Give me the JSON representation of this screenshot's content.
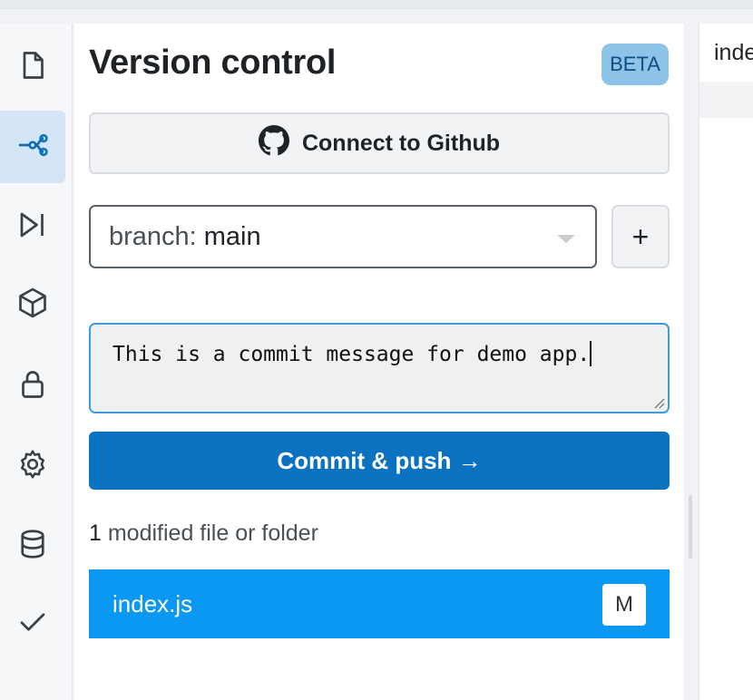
{
  "panel": {
    "title": "Version control",
    "badge": "BETA",
    "github_button": "Connect to Github",
    "branch": {
      "label": "branch:",
      "value": "main"
    },
    "add_branch": "+",
    "commit_message": "This is a commit message for demo app.",
    "push_button": "Commit & push →",
    "modified": {
      "count": "1",
      "text": "modified file or folder"
    },
    "files": [
      {
        "name": "index.js",
        "status": "M"
      }
    ]
  },
  "sidebar": {
    "items": [
      {
        "icon": "file-icon",
        "active": false
      },
      {
        "icon": "version-control-icon",
        "active": true
      },
      {
        "icon": "run-icon",
        "active": false
      },
      {
        "icon": "package-icon",
        "active": false
      },
      {
        "icon": "lock-icon",
        "active": false
      },
      {
        "icon": "gear-icon",
        "active": false
      },
      {
        "icon": "database-icon",
        "active": false
      },
      {
        "icon": "check-icon",
        "active": false
      }
    ]
  },
  "editor": {
    "tab_label": "index.js"
  },
  "colors": {
    "accent": "#0b72c2",
    "file_row": "#0a98f2",
    "active_rail": "#d4e5f5",
    "badge_bg": "#8ec3e8"
  }
}
